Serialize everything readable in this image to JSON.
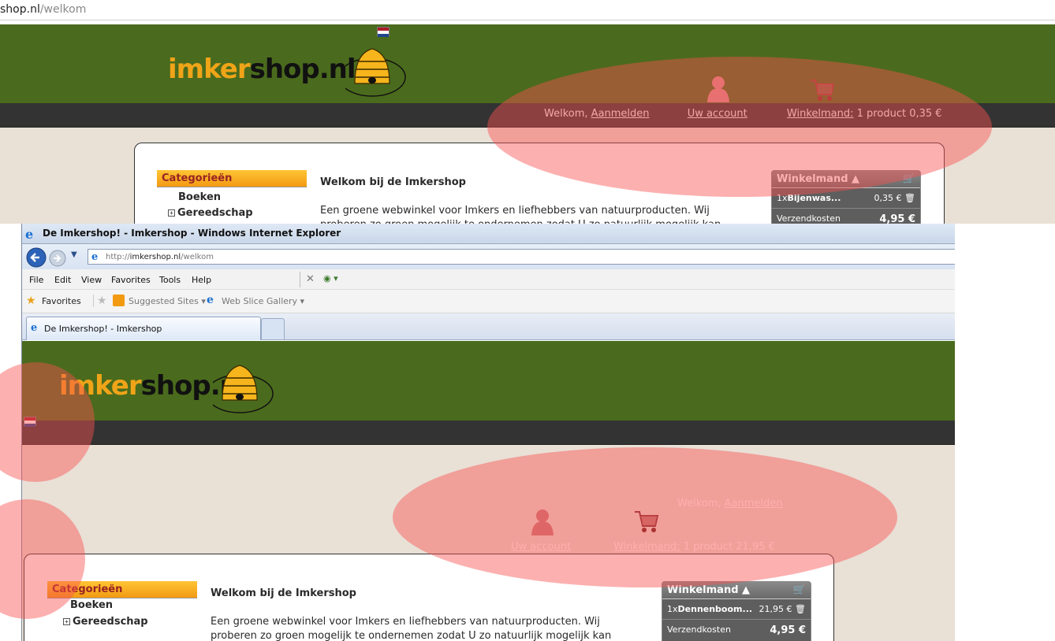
{
  "top_shot": {
    "url_host": "shop.nl",
    "url_path": "/welkom",
    "logo_orange": "imker",
    "logo_black": "shop",
    "logo_tld": ".nl",
    "nav": {
      "welcome": "Welkom,",
      "login": "Aanmelden",
      "account": "Uw account",
      "cart_label": "Winkelmand:",
      "cart_value": "1 product 0,35 €"
    },
    "sidebar": {
      "title": "Categorieën",
      "items": [
        "Boeken",
        "Gereedschap"
      ]
    },
    "main": {
      "title": "Welkom bij de Imkershop",
      "text": "Een groene webwinkel voor Imkers en liefhebbers van natuurproducten. Wij proberen zo groen mogelijk te ondernemen zodat U zo natuurlijk mogelijk kan"
    },
    "cart": {
      "title": "Winkelmand",
      "item_qty": "1x",
      "item_name": "Bijenwas...",
      "item_price": "0,35 €",
      "shipping_label": "Verzendkosten",
      "shipping_value": "4,95 €"
    }
  },
  "ie": {
    "window_title": "De Imkershop! - Imkershop - Windows Internet Explorer",
    "address_prefix": "http://",
    "address_host": "imkershop.nl",
    "address_path": "/welkom",
    "menu": [
      "File",
      "Edit",
      "View",
      "Favorites",
      "Tools",
      "Help"
    ],
    "favorites": "Favorites",
    "suggested_sites": "Suggested Sites",
    "web_slice_gallery": "Web Slice Gallery",
    "tab_title": "De Imkershop! - Imkershop"
  },
  "bottom_shot": {
    "logo_orange": "imker",
    "logo_black": "shop",
    "logo_tld": ".nl",
    "nav": {
      "welcome": "Welkom,",
      "login": "Aanmelden",
      "account": "Uw account",
      "cart_label": "Winkelmand:",
      "cart_value": "1 product  21,95 €"
    },
    "sidebar": {
      "title": "Categorieën",
      "items": [
        "Boeken",
        "Gereedschap"
      ]
    },
    "main": {
      "title": "Welkom bij de Imkershop",
      "text": "Een groene webwinkel voor Imkers en liefhebbers van natuurproducten. Wij proberen zo groen mogelijk te ondernemen zodat U zo natuurlijk mogelijk kan"
    },
    "cart": {
      "title": "Winkelmand",
      "item_qty": "1x",
      "item_name": "Dennenboom...",
      "item_price": "21,95 €",
      "shipping_label": "Verzendkosten",
      "shipping_value": "4,95 €"
    }
  },
  "colors": {
    "header_green": "#4a6b1d",
    "logo_orange": "#f0a418",
    "highlight": "rgba(250,80,80,0.45)"
  },
  "icons": [
    "nl-flag-icon",
    "beehive-icon",
    "user-icon",
    "cart-icon",
    "trash-icon",
    "ie-logo-icon",
    "back-icon",
    "forward-icon",
    "star-icon"
  ]
}
